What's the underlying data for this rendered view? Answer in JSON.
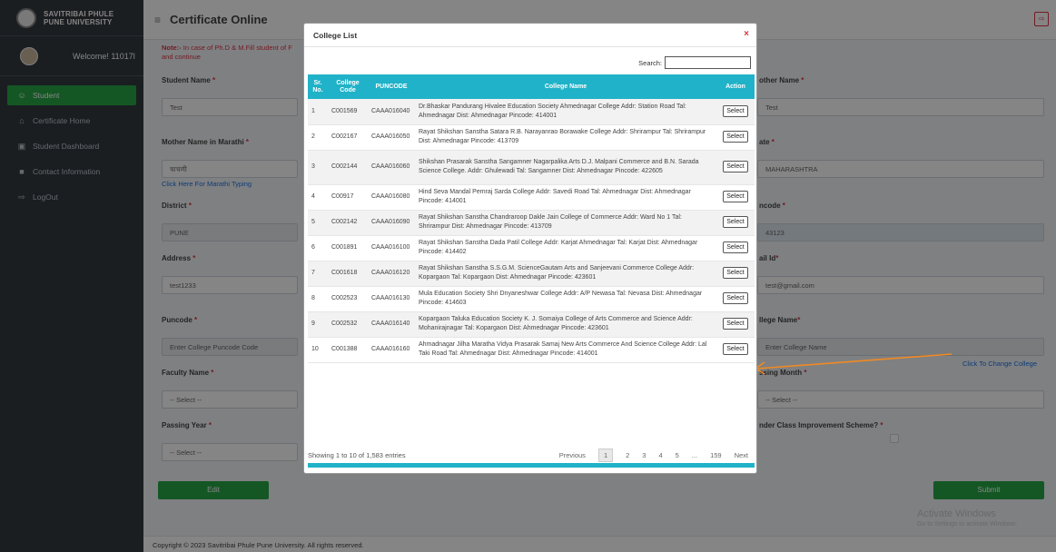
{
  "brand": {
    "line1": "SAVITRIBAI PHULE",
    "line2": "PUNE UNIVERSITY"
  },
  "user": {
    "welcome": "Welcome! 11017l"
  },
  "sidebar": {
    "items": [
      {
        "label": "Student",
        "icon": "user-icon"
      },
      {
        "label": "Certificate Home",
        "icon": "home-icon"
      },
      {
        "label": "Student Dashboard",
        "icon": "dashboard-icon"
      },
      {
        "label": "Contact Information",
        "icon": "contact-icon"
      },
      {
        "label": "LogOut",
        "icon": "logout-icon"
      }
    ]
  },
  "header": {
    "title": "Certificate Online"
  },
  "note": {
    "bold": "Note:-",
    "text": " In case of Ph.D & M.Fill student of F",
    "text2": "and continue"
  },
  "form": {
    "student_name_label": "Student Name",
    "student_name_value": "Test",
    "mother_name_marathi_label": "Mother Name in Marathi",
    "mother_name_marathi_value": "चाचणी",
    "marathi_typing_link": "Click Here For Marathi Typing",
    "district_label": "District",
    "district_value": "PUNE",
    "address_label": "Address",
    "address_value": "test1233",
    "puncode_label": "Puncode",
    "puncode_placeholder": "Enter College Puncode Code",
    "faculty_label": "Faculty Name",
    "faculty_value": "-- Select --",
    "passing_year_label": "Passing Year",
    "passing_year_value": "-- Select --",
    "edit_button": "Edit",
    "mother_name_label": "other Name",
    "mother_name_value": "Test",
    "state_label": "ate",
    "state_value": "MAHARASHTRA",
    "pincode_label": "ncode",
    "pincode_value": "43123",
    "email_label": "ail Id",
    "email_value": "test@gmail.com",
    "college_name_label": "llege Name",
    "college_name_placeholder": "Enter College Name",
    "change_college_link": "Click To Change College",
    "passing_month_label": "ssing Month",
    "passing_month_value": "-- Select --",
    "improvement_label": "nder Class Improvement Scheme?",
    "submit_button": "Submit"
  },
  "footer": {
    "text": "Copyright © 2023 Savitribai Phule Pune University. All rights reserved."
  },
  "watermark": {
    "line1": "Activate Windows",
    "line2": "Go to Settings to activate Windows."
  },
  "modal": {
    "title": "College List",
    "close": "×",
    "search_label": "Search:",
    "columns": [
      "Sr. No.",
      "College Code",
      "PUNCODE",
      "College Name",
      "Action"
    ],
    "rows": [
      {
        "sr": "1",
        "code": "C001569",
        "puncode": "CAAA016040",
        "name": "Dr.Bhaskar Pandurang Hivalee Education Society Ahmednagar College Addr: Station Road Tal: Ahmednagar Dist: Ahmednagar Pincode: 414001",
        "action": "Select"
      },
      {
        "sr": "2",
        "code": "C002167",
        "puncode": "CAAA016050",
        "name": "Rayat Shikshan Sanstha Satara R.B. Narayanrao Borawake College Addr: Shrirampur Tal: Shrirampur Dist: Ahmednagar Pincode: 413709",
        "action": "Select"
      },
      {
        "sr": "3",
        "code": "C002144",
        "puncode": "CAAA016060",
        "name": "Shikshan Prasarak Sanstha Sangamner Nagarpalika Arts D.J. Malpani Commerce and B.N. Sarada Science College. Addr: Ghulewadi Tal: Sangamner Dist: Ahmednagar Pincode: 422605",
        "action": "Select"
      },
      {
        "sr": "4",
        "code": "C00917",
        "puncode": "CAAA016080",
        "name": "Hind Seva Mandal Pemraj Sarda College Addr: Savedi Road Tal: Ahmednagar Dist: Ahmednagar Pincode: 414001",
        "action": "Select"
      },
      {
        "sr": "5",
        "code": "C002142",
        "puncode": "CAAA016090",
        "name": "Rayat Shikshan Sanstha Chandraroop Dakle Jain College of Commerce Addr: Ward No 1 Tal: Shrirampur Dist: Ahmednagar Pincode: 413709",
        "action": "Select"
      },
      {
        "sr": "6",
        "code": "C001891",
        "puncode": "CAAA016100",
        "name": "Rayat Shikshan Sanstha Dada Patil College Addr: Karjat Ahmednagar Tal: Karjat Dist: Ahmednagar Pincode: 414402",
        "action": "Select"
      },
      {
        "sr": "7",
        "code": "C001618",
        "puncode": "CAAA016120",
        "name": "Rayat Shikshan Sanstha S.S.G.M. ScienceGautam Arts and Sanjeevani Commerce College Addr: Kopargaon Tal: Kopargaon Dist: Ahmednagar Pincode: 423601",
        "action": "Select"
      },
      {
        "sr": "8",
        "code": "C002523",
        "puncode": "CAAA016130",
        "name": "Mula Education Society Shri Dnyaneshwar College Addr: A/P Newasa Tal: Nevasa Dist: Ahmednagar Pincode: 414603",
        "action": "Select"
      },
      {
        "sr": "9",
        "code": "C002532",
        "puncode": "CAAA016140",
        "name": "Kopargaon Taluka Education Society K. J. Somaiya College of Arts Commerce and Science Addr: Mohanirajnagar Tal: Kopargaon Dist: Ahmednagar Pincode: 423601",
        "action": "Select"
      },
      {
        "sr": "10",
        "code": "C001388",
        "puncode": "CAAA016160",
        "name": "Ahmadnagar Jilha Maratha Vidya Prasarak Samaj New Arts Commerce And Science College Addr: Lal Taki Road Tal: Ahmednagar Dist: Ahmednagar Pincode: 414001",
        "action": "Select"
      }
    ],
    "info": "Showing 1 to 10 of 1,583 entries",
    "pagination": {
      "previous": "Previous",
      "pages": [
        "1",
        "2",
        "3",
        "4",
        "5",
        "...",
        "159"
      ],
      "next": "Next",
      "current": "1"
    }
  }
}
